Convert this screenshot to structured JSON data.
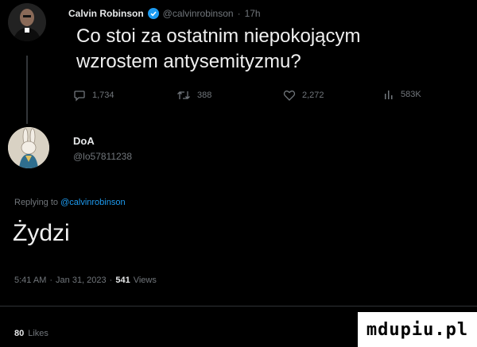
{
  "quoted_tweet": {
    "author_name": "Calvin Robinson",
    "handle": "@calvinrobinson",
    "time": "17h",
    "separator": "·",
    "text_line1": "Co stoi za ostatnim niepokojącym",
    "text_line2": "wzrostem antysemityzmu?",
    "replies": "1,734",
    "retweets": "388",
    "likes": "2,272",
    "views": "583K"
  },
  "reply": {
    "author_name": "DoA",
    "handle": "@lo57811238",
    "replying_prefix": "Replying to",
    "replying_to": "@calvinrobinson",
    "text": "Żydzi",
    "time": "5:41 AM",
    "date": "Jan 31, 2023",
    "sep": "·",
    "views_count": "541",
    "views_label": "Views",
    "likes_count": "80",
    "likes_label": "Likes"
  },
  "watermark": {
    "text": "mdupiu.pl"
  },
  "colors": {
    "accent": "#1d9bf0",
    "muted": "#71767b",
    "verified": "#1d9bf0"
  }
}
